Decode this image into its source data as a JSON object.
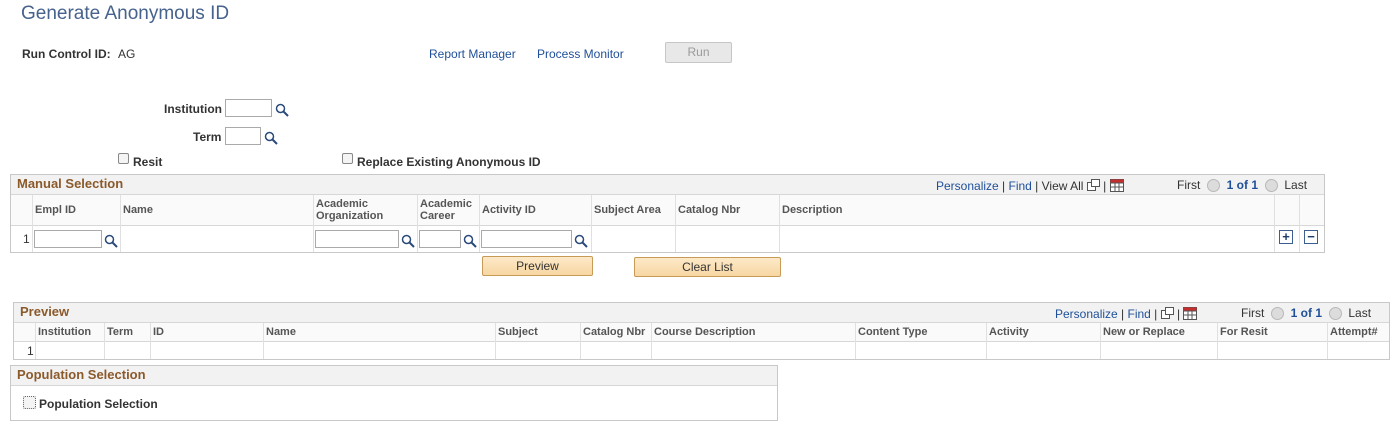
{
  "page": {
    "title": "Generate Anonymous ID"
  },
  "run_control": {
    "label": "Run Control ID:",
    "value": "AG"
  },
  "links": {
    "report_manager": "Report Manager",
    "process_monitor": "Process Monitor"
  },
  "run_button": "Run",
  "form": {
    "institution_label": "Institution",
    "term_label": "Term",
    "resit_label": "Resit",
    "replace_label": "Replace Existing Anonymous ID"
  },
  "manual_selection": {
    "title": "Manual Selection",
    "nav": {
      "personalize": "Personalize",
      "find": "Find",
      "view_all": "View All",
      "first": "First",
      "count": "1 of 1",
      "last": "Last"
    },
    "columns": [
      "Empl ID",
      "Name",
      "Academic Organization",
      "Academic Career",
      "Activity ID",
      "Subject Area",
      "Catalog Nbr",
      "Description"
    ],
    "row_number": "1"
  },
  "buttons": {
    "preview": "Preview",
    "clear_list": "Clear List"
  },
  "preview": {
    "title": "Preview",
    "nav": {
      "personalize": "Personalize",
      "find": "Find",
      "first": "First",
      "count": "1 of 1",
      "last": "Last"
    },
    "columns": [
      "Institution",
      "Term",
      "ID",
      "Name",
      "Subject",
      "Catalog Nbr",
      "Course Description",
      "Content Type",
      "Activity",
      "New or Replace",
      "For Resit",
      "Attempt#"
    ],
    "row_number": "1"
  },
  "population": {
    "title": "Population Selection",
    "checkbox_label": "Population Selection"
  },
  "icons": [
    "search-icon",
    "new-window-icon",
    "download-grid-icon",
    "arrow-left-icon",
    "arrow-right-icon",
    "plus-icon",
    "minus-icon"
  ]
}
